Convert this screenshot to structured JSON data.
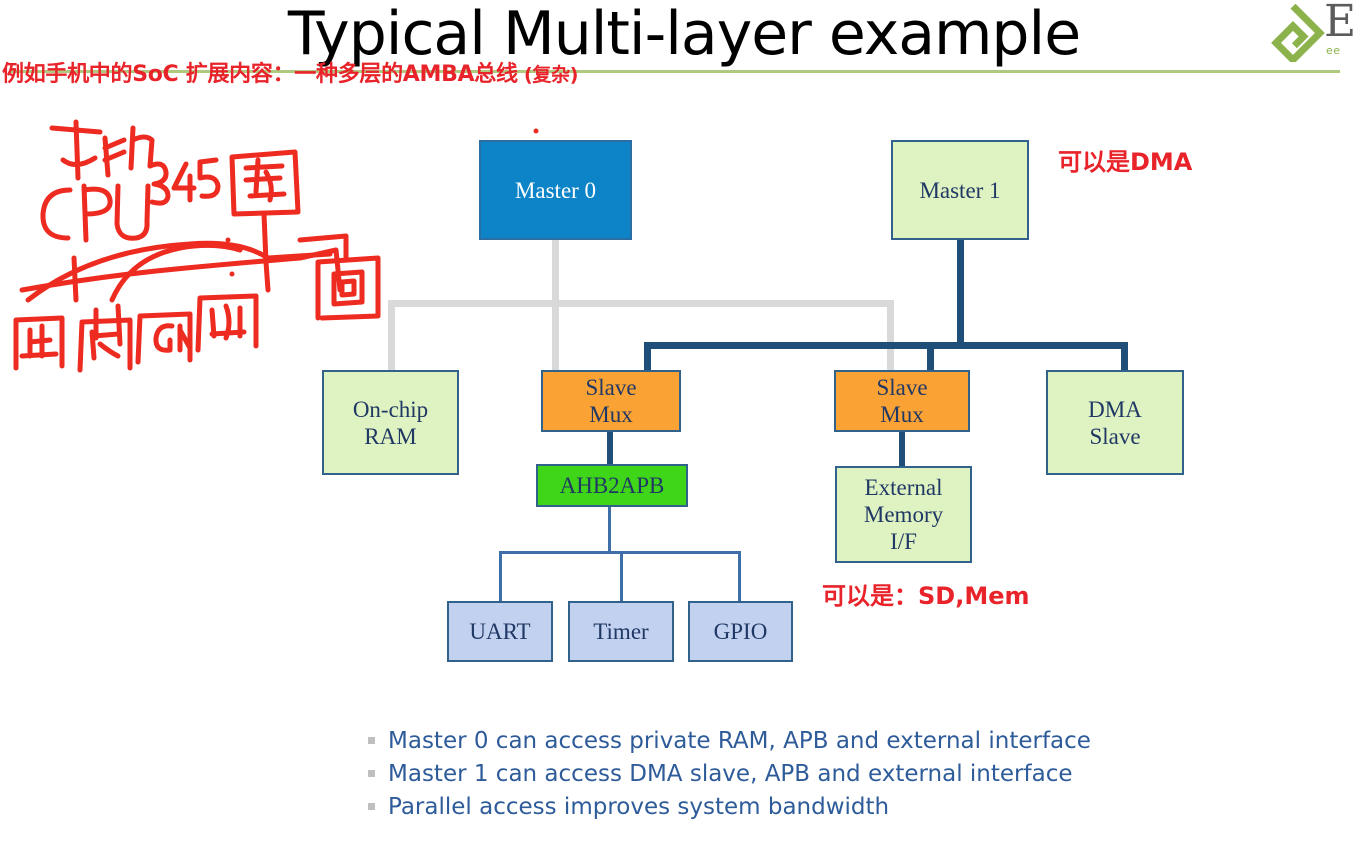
{
  "slide": {
    "title": "Typical Multi-layer example",
    "red_subtitle_main": "例如手机中的SoC  扩展内容：一种多层的AMBA总线",
    "red_subtitle_tail": " (复杂)",
    "rule_color": "#AFC97E",
    "red_color": "#E8232A"
  },
  "logo": {
    "mark_name": "green-diamond-logo",
    "letter": "E",
    "tagline": "ee"
  },
  "diagram": {
    "nodes": {
      "master0": {
        "label": "Master 0",
        "fill": "#0D84C8",
        "text_color": "#FFFFFF"
      },
      "master1": {
        "label": "Master 1",
        "fill": "#DFF3C2",
        "text_color": "#1F3864"
      },
      "onchip_ram": {
        "line1": "On-chip",
        "line2": "RAM",
        "fill": "#DFF3C2"
      },
      "slave_mux_left": {
        "line1": "Slave",
        "line2": "Mux",
        "fill": "#FBA235"
      },
      "slave_mux_right": {
        "line1": "Slave",
        "line2": "Mux",
        "fill": "#FBA235"
      },
      "dma_slave": {
        "line1": "DMA",
        "line2": "Slave",
        "fill": "#DFF3C2"
      },
      "ahb2apb": {
        "label": "AHB2APB",
        "fill": "#3FD519"
      },
      "external_memory": {
        "line1": "External",
        "line2": "Memory",
        "line3": "I/F",
        "fill": "#DFF3C2"
      },
      "uart": {
        "label": "UART",
        "fill": "#C3D1F0"
      },
      "timer": {
        "label": "Timer",
        "fill": "#C3D1F0"
      },
      "gpio": {
        "label": "GPIO",
        "fill": "#C3D1F0"
      }
    },
    "bus_colors": {
      "master0_bus": "#D9D9D9",
      "master1_bus": "#1F4E79",
      "apb_bus": "#3E6FA8"
    }
  },
  "annotations": {
    "dma_note": "可以是DMA",
    "sd_mem_note": "可以是：SD,Mem",
    "handwriting": [
      "手机",
      "CPU",
      "845",
      "整",
      "内",
      "图"
    ]
  },
  "bullets": [
    "Master 0 can access private RAM, APB and external interface",
    "Master 1 can access DMA slave, APB and external interface",
    "Parallel access improves system bandwidth"
  ]
}
